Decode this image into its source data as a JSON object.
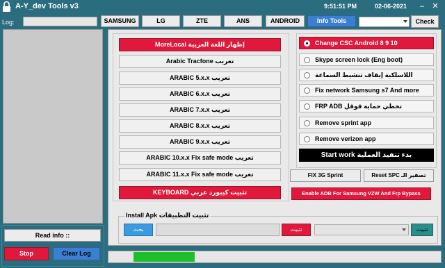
{
  "app": {
    "title": "A-Y_dev Tools v3",
    "clock": "9:51:51 PM",
    "date": "02-06-2021"
  },
  "window_controls": {
    "minimize": "–",
    "close": "✕"
  },
  "top": {
    "log_label": "Log:",
    "tabs": [
      "SAMSUNG",
      "LG",
      "ZTE",
      "ANS",
      "ANDROID",
      "Info Tools"
    ],
    "active_tab": "Info Tools",
    "check_label": "Check"
  },
  "left_buttons": [
    "MoreLocal إظهار اللغة العربية",
    "Arabic Tracfone تعريب",
    "ARABIC 5.x.x تعريب",
    "ARABIC 6.x.x تعريب",
    "ARABIC 7.x.x تعريب",
    "ARABIC 8.x.x تعريب",
    "ARABIC  9.x.x تعريب",
    "ARABIC 10.x.x Fix safe mode تعريب",
    "ARABIC 11.x.x Fix safe mode تعريب",
    "KEYBOARD تثبيت كيبورد عربي"
  ],
  "right_options": [
    "Change CSC Android 8  9  10",
    "Skype screen lock (Eng boot)",
    "اللاسلكية إيقاف تنشيط السماعة",
    "Fix network Samsung s7 And more",
    "FRP ADB  تخطي حماية قوقل",
    "Remove sprint app",
    "Remove verizon app"
  ],
  "selected_option": 0,
  "start_work": "Start work  بدء تنفيذ العملية",
  "fix3g": "FIX 3G Sprint",
  "reset_spc": "Reset SPC",
  "reset_spc_ar": "تصفير الـ",
  "enable_adb": "Enable ADB For Samsung VZW And Frp Bypass",
  "apk": {
    "legend": "Install Apk  تثبيت التطبيقات",
    "search": "بحث",
    "install": "تثبيت",
    "install2": "تثبيت"
  },
  "readinfo": "Read info ::",
  "stop": "Stop",
  "clear_log": "Clear Log",
  "progress": 0.18,
  "colors": {
    "accent_red": "#e0193c",
    "accent_blue": "#3b7fd1",
    "background": "#2b6d7e",
    "progress": "#1fbf2a"
  },
  "icons": {
    "app": "lock-icon"
  }
}
